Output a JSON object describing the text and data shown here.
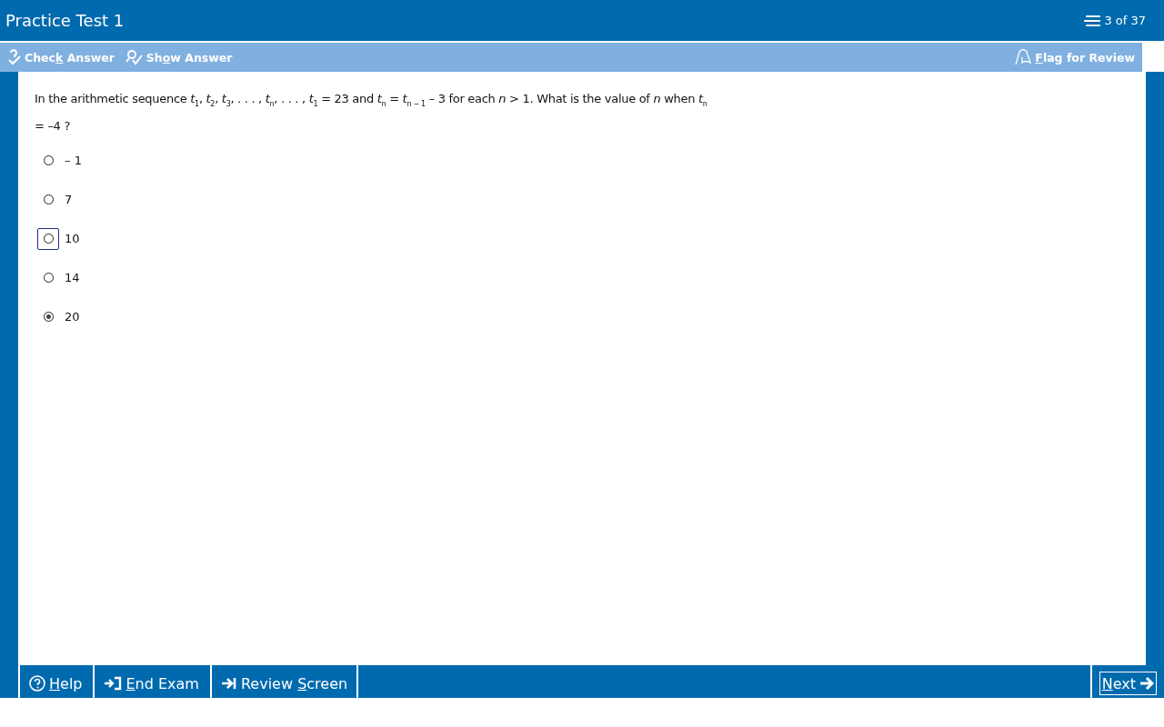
{
  "title": "Practice Test 1",
  "progress": "3 of 37",
  "toolbar": {
    "left": [
      {
        "kind": "check",
        "pre": "Chec",
        "key": "k",
        "post": " Answer"
      },
      {
        "kind": "show",
        "pre": "Sh",
        "key": "o",
        "post": "w Answer"
      }
    ],
    "right": [
      {
        "kind": "flag",
        "key": "F",
        "post": "lag for Review"
      }
    ]
  },
  "question": "In the arithmetic sequence *t*$_{1}$, *t*$_{2}$, *t*$_{3}$, . . . , *t*$_{n}$, . . . , *t*$_{1}$ = 23 and *t*$_{n}$ = *t*$_{n − 1}$ – 3 for each *n* > 1.  What is the value of *n* when *t*$_{n}$ = –4 ?",
  "options": [
    {
      "label": "– 1",
      "selected": false,
      "focused": false
    },
    {
      "label": "7",
      "selected": false,
      "focused": false
    },
    {
      "label": "10",
      "selected": false,
      "focused": true
    },
    {
      "label": "14",
      "selected": false,
      "focused": false
    },
    {
      "label": "20",
      "selected": true,
      "focused": false
    }
  ],
  "footer": {
    "left": [
      {
        "kind": "help",
        "key": "H",
        "post": "elp"
      },
      {
        "kind": "end",
        "key": "E",
        "post": "nd Exam"
      },
      {
        "kind": "review",
        "pre": "Review ",
        "key": "S",
        "post": "creen"
      }
    ],
    "right": [
      {
        "kind": "next",
        "key": "N",
        "post": "ext"
      }
    ]
  }
}
